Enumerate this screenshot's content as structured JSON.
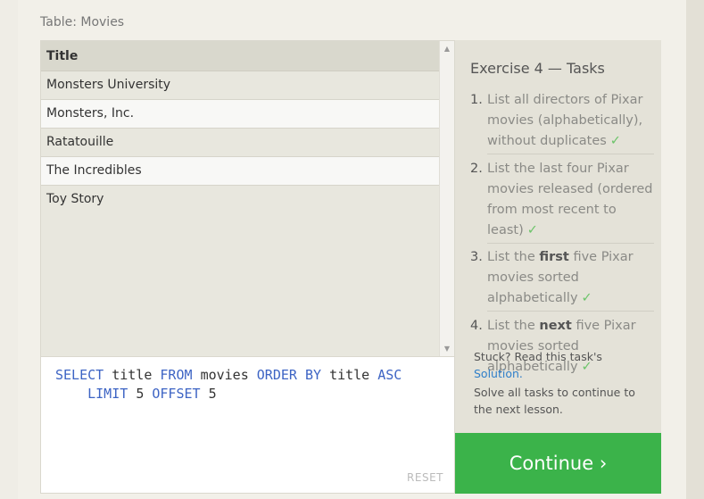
{
  "table_label": "Table: Movies",
  "table": {
    "header": "Title",
    "rows": [
      "Monsters University",
      "Monsters, Inc.",
      "Ratatouille",
      "The Incredibles",
      "Toy Story"
    ]
  },
  "scroll_up_icon": "▲",
  "scroll_down_icon": "▼",
  "query": {
    "select": "SELECT",
    "title1": "title",
    "from": "FROM",
    "movies": "movies",
    "order_by": "ORDER BY",
    "title2": "title",
    "asc": "ASC",
    "limit": "LIMIT",
    "limit_val": "5",
    "offset": "OFFSET",
    "offset_val": "5"
  },
  "reset_label": "RESET",
  "tasks": {
    "title": "Exercise 4 — Tasks",
    "check_icon": "✓",
    "items": [
      {
        "num": "1.",
        "text": "List all directors of Pixar movies (alphabetically), without duplicates"
      },
      {
        "num": "2.",
        "text": "List the last four Pixar movies released (ordered from most recent to least)"
      },
      {
        "num": "3.",
        "pre": "List the",
        "bold": "first",
        "post": "five Pixar movies sorted alphabetically"
      },
      {
        "num": "4.",
        "pre": "List the",
        "bold": "next",
        "post": "five Pixar movies sorted alphabetically"
      }
    ]
  },
  "stuck": {
    "prefix": "Stuck? Read this task's",
    "link": "Solution.",
    "message": "Solve all tasks to continue to the next lesson."
  },
  "continue_label": "Continue ›"
}
